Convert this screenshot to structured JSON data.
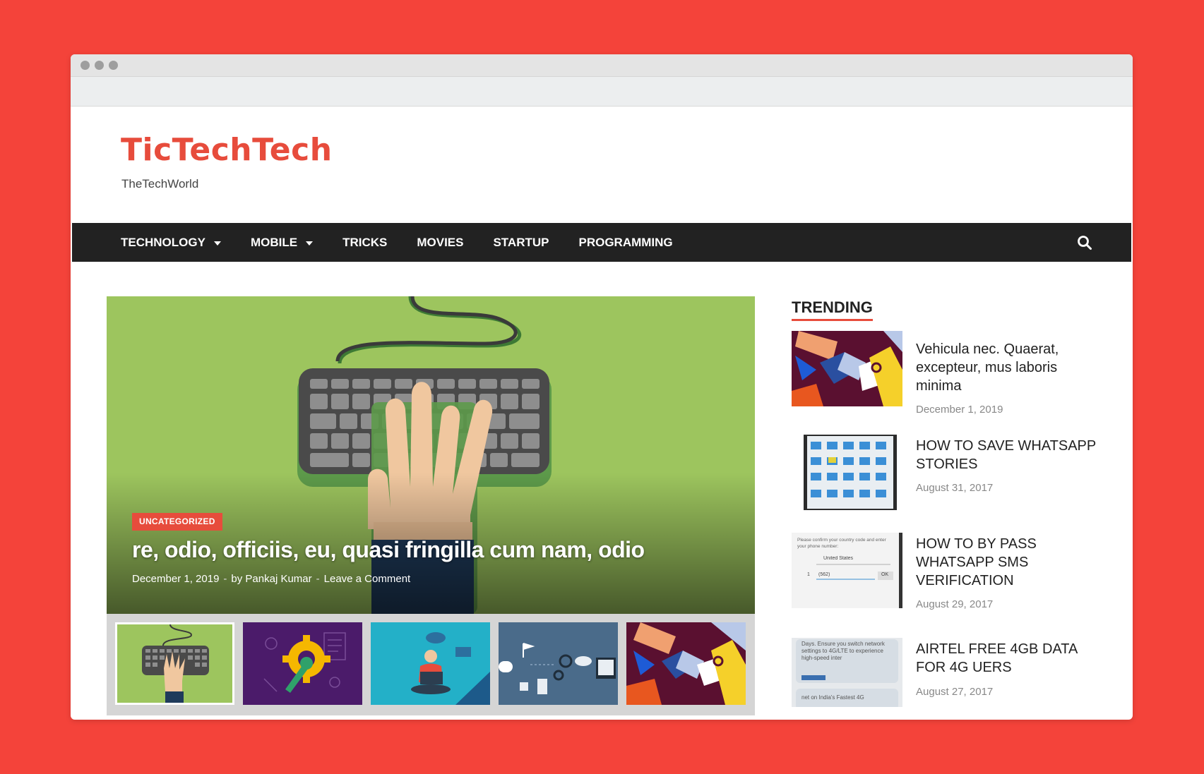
{
  "site": {
    "title": "TicTechTech",
    "tagline": "TheTechWorld"
  },
  "nav": {
    "items": [
      {
        "label": "TECHNOLOGY",
        "dropdown": true
      },
      {
        "label": "MOBILE",
        "dropdown": true
      },
      {
        "label": "TRICKS",
        "dropdown": false
      },
      {
        "label": "MOVIES",
        "dropdown": false
      },
      {
        "label": "STARTUP",
        "dropdown": false
      },
      {
        "label": "PROGRAMMING",
        "dropdown": false
      }
    ],
    "search_icon": "search-icon"
  },
  "hero": {
    "category": "UNCATEGORIZED",
    "title": "re, odio, officiis, eu, quasi fringilla cum nam, odio",
    "date": "December 1, 2019",
    "separator": "-",
    "author": "by Pankaj Kumar",
    "comment": "Leave a Comment"
  },
  "thumbnails": [
    "keyboard-hand",
    "gear-wrench",
    "laptop-person",
    "devices-flow",
    "puzzle-hands"
  ],
  "trending": {
    "title": "TRENDING",
    "items": [
      {
        "title": "Vehicula nec. Quaerat, excepteur, mus laboris minima",
        "date": "December 1, 2019"
      },
      {
        "title": "HOW TO SAVE WHATSAPP STORIES",
        "date": "August 31, 2017"
      },
      {
        "title": "HOW TO BY PASS WHATSAPP SMS VERIFICATION",
        "date": "August 29, 2017"
      },
      {
        "title": "AIRTEL FREE 4GB DATA FOR 4G UERS",
        "date": "August 27, 2017"
      }
    ],
    "thumb2_text": {
      "confirm": "Please confirm your country code and enter your phone number:",
      "country": "United States",
      "code": "1",
      "phone": "(562)",
      "ok": "OK"
    },
    "thumb3_text": {
      "line1": "Days. Ensure you switch network settings to 4G/LTE to experience high-speed inter",
      "line2": "net on India's Fastest 4G"
    }
  },
  "colors": {
    "accent": "#e74c3c",
    "nav_bg": "#222222",
    "page_bg": "#f4433a"
  }
}
